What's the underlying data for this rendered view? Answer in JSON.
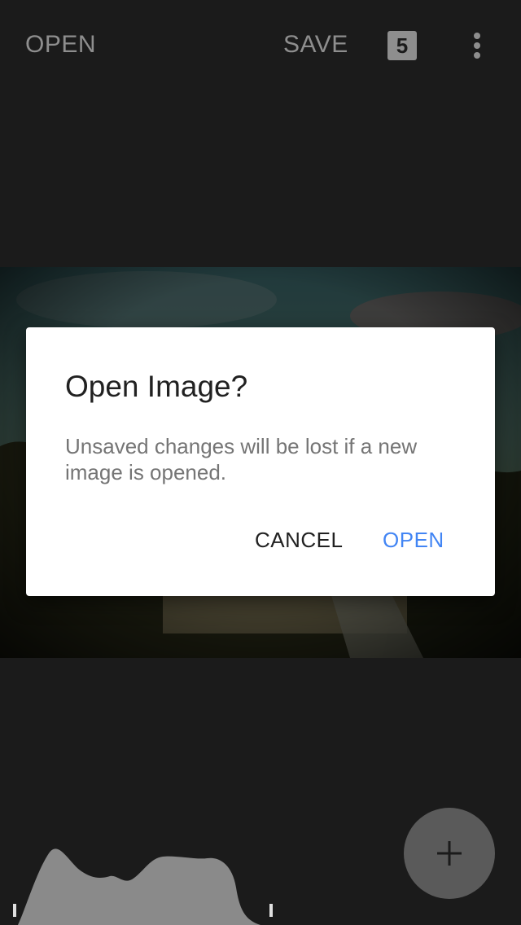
{
  "toolbar": {
    "open_label": "OPEN",
    "save_label": "SAVE",
    "badge_count": "5",
    "more_icon": "more-vert-icon"
  },
  "dialog": {
    "title": "Open Image?",
    "message": "Unsaved changes will be lost if a new image is opened.",
    "cancel_label": "CANCEL",
    "open_label": "OPEN"
  },
  "fab": {
    "icon": "plus-icon"
  },
  "colors": {
    "background": "#1b1b1b",
    "toolbar_text": "#8e8e8e",
    "dialog_bg": "#ffffff",
    "dialog_title": "#212121",
    "dialog_body": "#757575",
    "accent": "#4285f4",
    "fab": "#5a5a5a",
    "histogram": "#8a8a8a"
  }
}
